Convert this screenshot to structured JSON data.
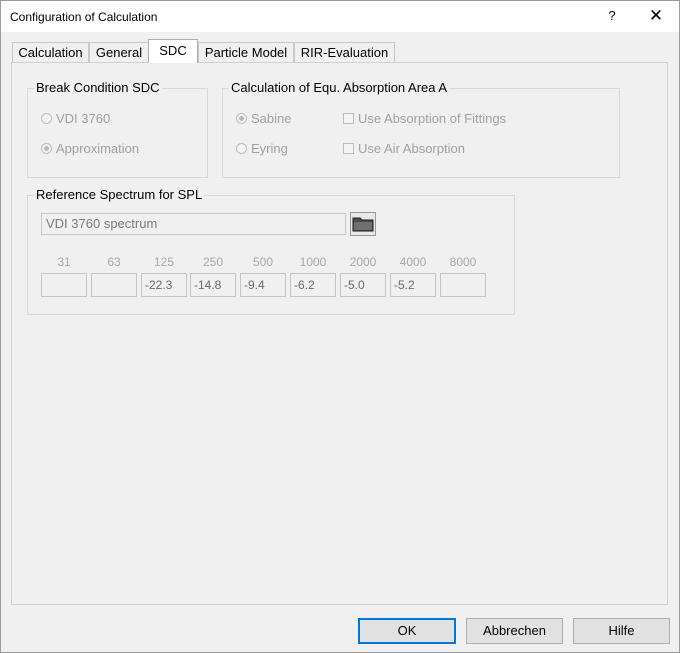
{
  "window": {
    "title": "Configuration of Calculation",
    "help_label": "?",
    "close_label": "✕"
  },
  "tabs": [
    {
      "label": "Calculation",
      "active": false
    },
    {
      "label": "General",
      "active": false
    },
    {
      "label": "SDC",
      "active": true
    },
    {
      "label": "Particle Model",
      "active": false
    },
    {
      "label": "RIR-Evaluation",
      "active": false
    }
  ],
  "break_condition": {
    "title": "Break Condition SDC",
    "options": [
      {
        "label": "VDI 3760",
        "selected": false
      },
      {
        "label": "Approximation",
        "selected": true
      }
    ]
  },
  "absorption_area": {
    "title": "Calculation of Equ. Absorption Area A",
    "methods": [
      {
        "label": "Sabine",
        "selected": true
      },
      {
        "label": "Eyring",
        "selected": false
      }
    ],
    "checkboxes": [
      {
        "label": "Use Absorption of Fittings",
        "checked": false
      },
      {
        "label": "Use Air Absorption",
        "checked": false
      }
    ]
  },
  "reference_spectrum": {
    "title": "Reference Spectrum for SPL",
    "spectrum_name": "VDI 3760 spectrum",
    "folder_icon": "folder-icon",
    "bands": [
      {
        "freq": "31",
        "value": ""
      },
      {
        "freq": "63",
        "value": ""
      },
      {
        "freq": "125",
        "value": "-22.3"
      },
      {
        "freq": "250",
        "value": "-14.8"
      },
      {
        "freq": "500",
        "value": "-9.4"
      },
      {
        "freq": "1000",
        "value": "-6.2"
      },
      {
        "freq": "2000",
        "value": "-5.0"
      },
      {
        "freq": "4000",
        "value": "-5.2"
      },
      {
        "freq": "8000",
        "value": ""
      }
    ]
  },
  "buttons": {
    "ok": "OK",
    "cancel": "Abbrechen",
    "help": "Hilfe"
  }
}
